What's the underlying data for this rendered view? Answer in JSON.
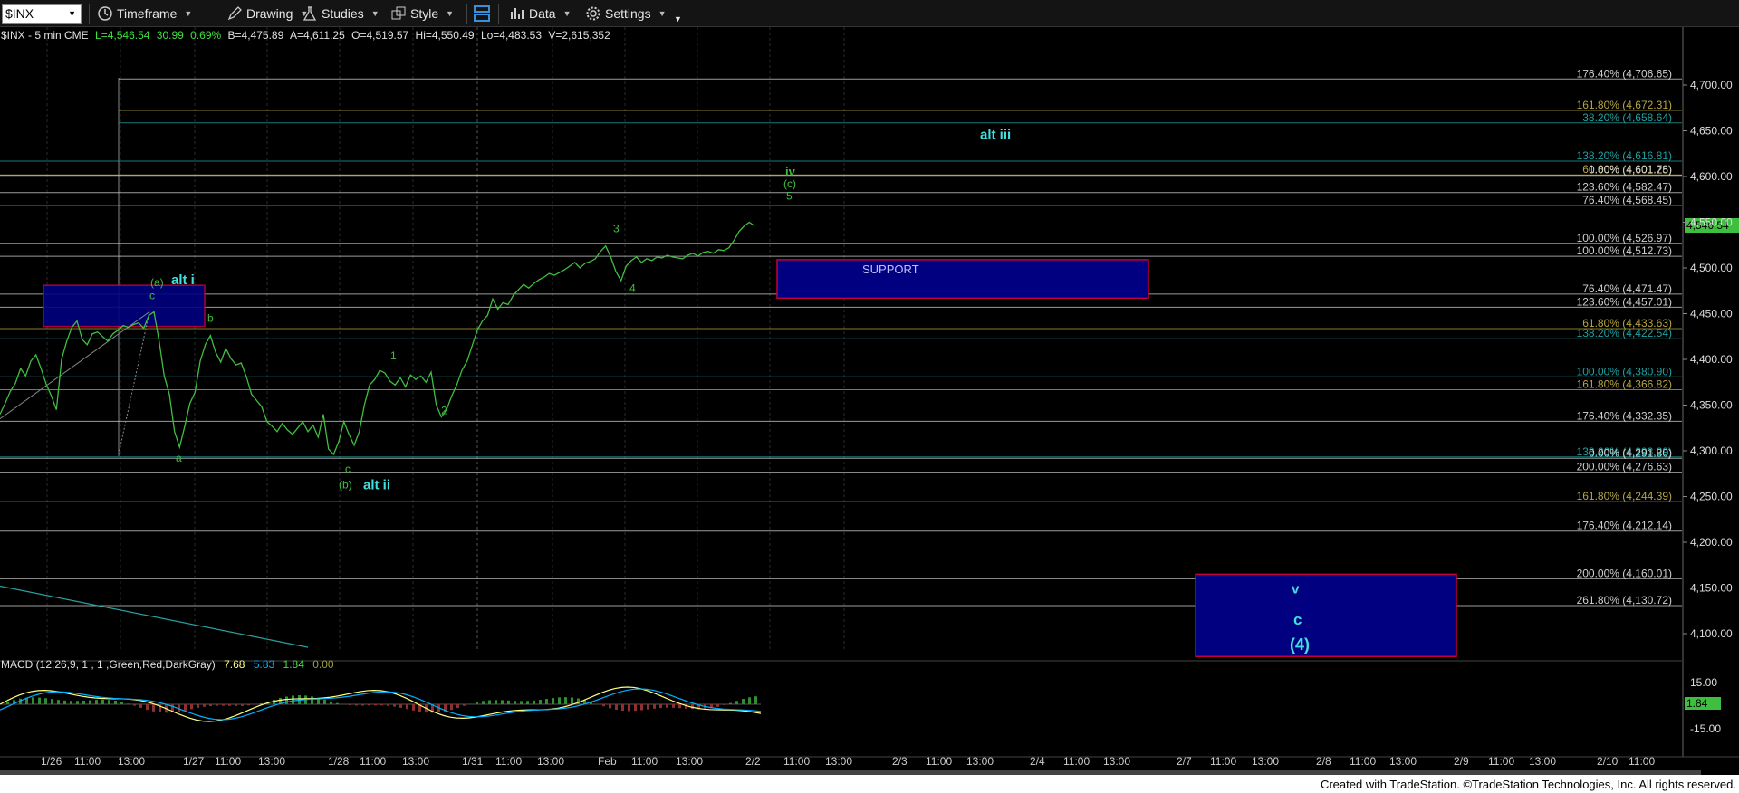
{
  "toolbar": {
    "symbol": "$INX",
    "timeframe": "Timeframe",
    "drawing": "Drawing",
    "studies": "Studies",
    "style": "Style",
    "data": "Data",
    "settings": "Settings"
  },
  "info": {
    "symbol_line": "$INX - 5 min  CME",
    "last": "L=4,546.54",
    "change": "30.99",
    "pct": "0.69%",
    "bid": "B=4,475.89",
    "ask": "A=4,611.25",
    "open": "O=4,519.57",
    "high": "Hi=4,550.49",
    "low": "Lo=4,483.53",
    "volume": "V=2,615,352"
  },
  "price_axis": {
    "ticks": [
      "4,700.00",
      "4,650.00",
      "4,600.00",
      "4,550.00",
      "4,500.00",
      "4,450.00",
      "4,400.00",
      "4,350.00",
      "4,300.00",
      "4,250.00",
      "4,200.00",
      "4,150.00",
      "4,100.00"
    ],
    "last_price": "4,546.54"
  },
  "macd_axis": {
    "ticks": [
      "15.00",
      "-15.00"
    ],
    "last": "1.84"
  },
  "fib_levels": [
    {
      "label": "176.40% (4,706.65)",
      "price": 4706.65,
      "color": "#d0d0d0"
    },
    {
      "label": "161.80% (4,672.31)",
      "price": 4672.31,
      "color": "#b5a642"
    },
    {
      "label": "38.20% (4,658.64)",
      "price": 4658.64,
      "color": "#20a0a0"
    },
    {
      "label": "138.20% (4,616.81)",
      "price": 4616.81,
      "color": "#20a0a0"
    },
    {
      "label": "61.80% (4,601.78)",
      "price": 4601.78,
      "color": "#b5a642"
    },
    {
      "label": "0.00% (4,601.25)",
      "price": 4601.25,
      "color": "#d0d0d0"
    },
    {
      "label": "123.60% (4,582.47)",
      "price": 4582.47,
      "color": "#d0d0d0"
    },
    {
      "label": "76.40% (4,568.45)",
      "price": 4568.45,
      "color": "#d0d0d0"
    },
    {
      "label": "100.00% (4,526.97)",
      "price": 4526.97,
      "color": "#d0d0d0"
    },
    {
      "label": "100.00% (4,512.73)",
      "price": 4512.73,
      "color": "#d0d0d0"
    },
    {
      "label": "76.40% (4,471.47)",
      "price": 4471.47,
      "color": "#d0d0d0"
    },
    {
      "label": "123.60% (4,457.01)",
      "price": 4457.01,
      "color": "#d0d0d0"
    },
    {
      "label": "61.80% (4,433.63)",
      "price": 4433.63,
      "color": "#b5a642"
    },
    {
      "label": "138.20% (4,422.54)",
      "price": 4422.54,
      "color": "#20a0a0"
    },
    {
      "label": "100.00% (4,380.90)",
      "price": 4380.9,
      "color": "#20a0a0"
    },
    {
      "label": "161.80% (4,366.82)",
      "price": 4366.82,
      "color": "#b5a642"
    },
    {
      "label": "176.40% (4,332.35)",
      "price": 4332.35,
      "color": "#d0d0d0"
    },
    {
      "label": "138.20% (4,293.29)",
      "price": 4293.29,
      "color": "#20a0a0"
    },
    {
      "label": "0.00% (4,291.80)",
      "price": 4291.8,
      "color": "#d0d0d0"
    },
    {
      "label": "200.00% (4,276.63)",
      "price": 4276.63,
      "color": "#d0d0d0"
    },
    {
      "label": "161.80% (4,244.39)",
      "price": 4244.39,
      "color": "#b5a642"
    },
    {
      "label": "176.40% (4,212.14)",
      "price": 4212.14,
      "color": "#d0d0d0"
    },
    {
      "label": "200.00% (4,160.01)",
      "price": 4160.01,
      "color": "#d0d0d0"
    },
    {
      "label": "261.80% (4,130.72)",
      "price": 4130.72,
      "color": "#d0d0d0"
    }
  ],
  "time_axis": [
    "1/26",
    "11:00",
    "13:00",
    "1/27",
    "11:00",
    "13:00",
    "1/28",
    "11:00",
    "13:00",
    "1/31",
    "11:00",
    "13:00",
    "Feb",
    "11:00",
    "13:00",
    "2/2",
    "11:00",
    "13:00",
    "2/3",
    "11:00",
    "13:00",
    "2/4",
    "11:00",
    "13:00",
    "2/7",
    "11:00",
    "13:00",
    "2/8",
    "11:00",
    "13:00",
    "2/9",
    "11:00",
    "13:00",
    "2/10",
    "11:00"
  ],
  "wave_labels": {
    "alt_i": "alt i",
    "a_paren": "(a)",
    "c_top": "c",
    "b": "b",
    "a": "a",
    "c_bottom": "c",
    "b_paren": "(b)",
    "alt_ii": "alt ii",
    "one": "1",
    "two": "2",
    "three": "3",
    "four": "4",
    "iv": "iv",
    "c_paren": "(c)",
    "five": "5",
    "alt_iii": "alt iii",
    "v": "v",
    "c_big": "c",
    "four_paren": "(4)"
  },
  "support_label": "SUPPORT",
  "macd": {
    "name": "MACD (12,26,9, 1 , 1 ,Green,Red,DarkGray)",
    "macd": "7.68",
    "signal": "5.83",
    "hist": "1.84",
    "zero": "0.00"
  },
  "price_series": [
    4340,
    4352,
    4365,
    4374,
    4390,
    4382,
    4398,
    4405,
    4390,
    4373,
    4360,
    4345,
    4400,
    4420,
    4435,
    4442,
    4422,
    4416,
    4428,
    4430,
    4425,
    4420,
    4428,
    4432,
    4437,
    4435,
    4438,
    4440,
    4434,
    4448,
    4452,
    4420,
    4382,
    4362,
    4321,
    4304,
    4327,
    4352,
    4364,
    4398,
    4416,
    4426,
    4408,
    4397,
    4412,
    4401,
    4394,
    4396,
    4381,
    4362,
    4355,
    4348,
    4332,
    4327,
    4321,
    4330,
    4323,
    4318,
    4325,
    4332,
    4321,
    4328,
    4315,
    4340,
    4302,
    4296,
    4310,
    4332,
    4318,
    4306,
    4321,
    4350,
    4372,
    4378,
    4388,
    4385,
    4376,
    4372,
    4380,
    4370,
    4383,
    4378,
    4382,
    4375,
    4386,
    4350,
    4337,
    4345,
    4360,
    4372,
    4388,
    4398,
    4415,
    4432,
    4442,
    4448,
    4466,
    4455,
    4462,
    4460,
    4470,
    4476,
    4482,
    4478,
    4483,
    4487,
    4490,
    4494,
    4492,
    4495,
    4498,
    4502,
    4506,
    4500,
    4505,
    4507,
    4510,
    4518,
    4524,
    4512,
    4496,
    4486,
    4502,
    4508,
    4512,
    4506,
    4510,
    4508,
    4512,
    4511,
    4514,
    4512,
    4511,
    4510,
    4514,
    4516,
    4513,
    4517,
    4518,
    4516,
    4520,
    4519,
    4522,
    4530,
    4540,
    4546,
    4550,
    4546
  ],
  "colors": {
    "price": "#3fbf3f",
    "support_fill": "#000080",
    "support_border": "#c00040",
    "macd": "#ffff80",
    "signal": "#00b0ff"
  }
}
